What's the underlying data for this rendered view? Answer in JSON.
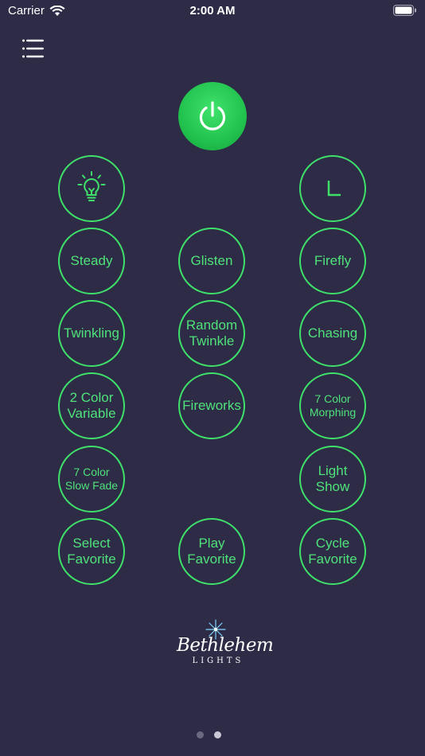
{
  "status_bar": {
    "carrier": "Carrier",
    "time": "2:00 AM"
  },
  "icons": {
    "menu": "menu-icon",
    "power": "power-icon",
    "bulb": "light-bulb-icon",
    "timer": "timer-icon",
    "wifi": "wifi-icon",
    "battery": "battery-icon"
  },
  "colors": {
    "background": "#2d2b46",
    "accent_green": "#3fe06a",
    "power_green": "#22c24e"
  },
  "modes": {
    "steady": "Steady",
    "glisten": "Glisten",
    "firefly": "Firefly",
    "twinkling": "Twinkling",
    "random_twinkle": "Random\nTwinkle",
    "chasing": "Chasing",
    "two_color_variable": "2 Color\nVariable",
    "fireworks": "Fireworks",
    "seven_color_morphing": "7 Color\nMorphing",
    "seven_color_slow_fade": "7 Color\nSlow Fade",
    "light_show": "Light\nShow",
    "select_favorite": "Select\nFavorite",
    "play_favorite": "Play\nFavorite",
    "cycle_favorite": "Cycle\nFavorite"
  },
  "logo": {
    "name": "Bethlehem",
    "sub": "LIGHTS"
  },
  "pager": {
    "page_count": 2,
    "current_page": 2
  }
}
